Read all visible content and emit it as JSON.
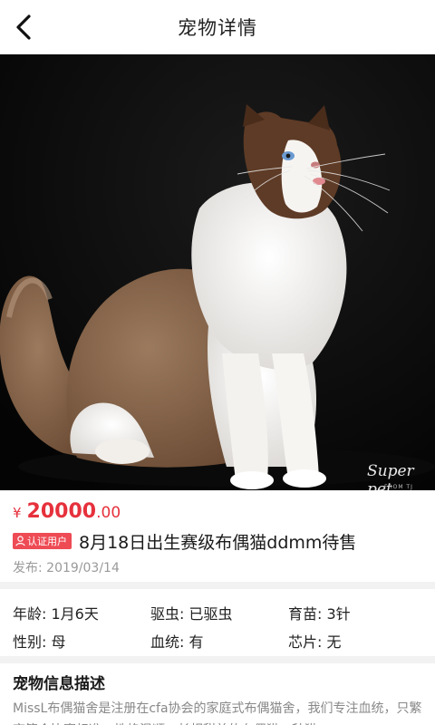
{
  "nav": {
    "title": "宠物详情",
    "back_icon": "chevron-left-icon"
  },
  "hero": {
    "alt": "布偶猫照片",
    "watermark": "Super pet",
    "watermark_sub": "FROM TJ"
  },
  "price": {
    "symbol": "¥",
    "integer": "20000",
    "decimal": ".00",
    "color": "#e6313c"
  },
  "listing": {
    "badge": "认证用户",
    "title": "8月18日出生赛级布偶猫ddmm待售",
    "date": "发布: 2019/03/14"
  },
  "attributes": {
    "age": "年龄: 1月6天",
    "deworm": "驱虫: 已驱虫",
    "vaccine": "育苗: 3针",
    "gender": "性别: 母",
    "pedigree": "血统: 有",
    "chip": "芯片: 无"
  },
  "description": {
    "title": "宠物信息描述",
    "text": "MissL布偶猫舍是注册在cfa协会的家庭式布偶猫舍，我们专注血统，只繁育符合比赛标准，性格温顺，长相甜美的布偶猫，种猫"
  }
}
